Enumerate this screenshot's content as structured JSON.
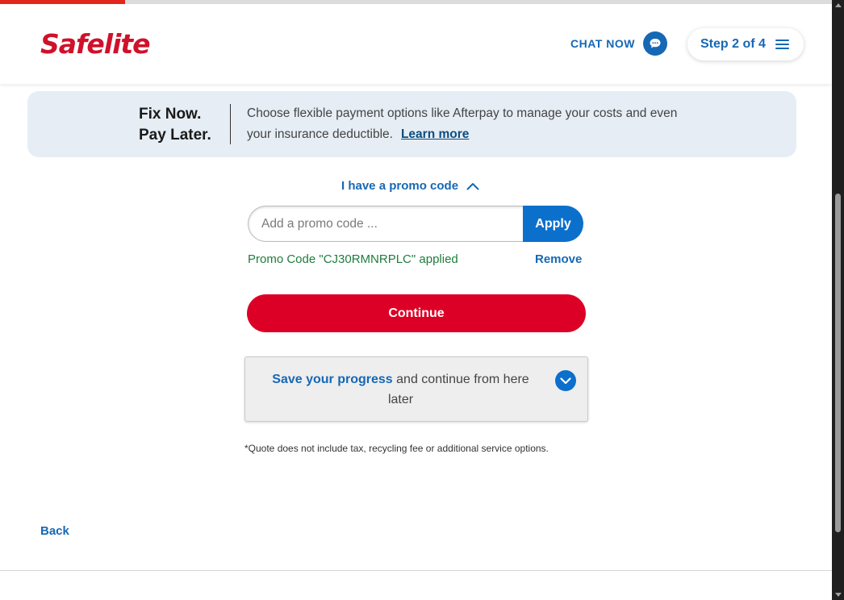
{
  "progress": {
    "fraction": 0.15,
    "color": "#e1261c"
  },
  "header": {
    "logo_text": "Safelite",
    "chat_label": "CHAT NOW",
    "chat_icon": "chat-bubble-icon",
    "step_label": "Step 2 of 4",
    "menu_icon": "hamburger-menu-icon"
  },
  "banner": {
    "title_line1": "Fix Now.",
    "title_line2": "Pay Later.",
    "text": "Choose flexible payment options like Afterpay to manage your costs and even your insurance deductible.",
    "link": "Learn more"
  },
  "promo": {
    "toggle_label": "I have a promo code",
    "toggle_icon": "chevron-up-icon",
    "placeholder": "Add a promo code ...",
    "value": "",
    "apply_label": "Apply",
    "applied_message": "Promo Code \"CJ30RMNRPLC\" applied",
    "remove_label": "Remove"
  },
  "continue_label": "Continue",
  "save_progress": {
    "strong": "Save your progress",
    "rest": " and continue from here later",
    "icon": "chevron-down-icon"
  },
  "disclaimer": "*Quote does not include tax, recycling fee or additional service options.",
  "back_label": "Back",
  "colors": {
    "brand_red": "#d0112b",
    "continue_red": "#dc0026",
    "link_blue": "#1668b4",
    "apply_blue": "#0b6fcc",
    "success_green": "#1e7d3c",
    "banner_bg": "#e6edf4"
  }
}
